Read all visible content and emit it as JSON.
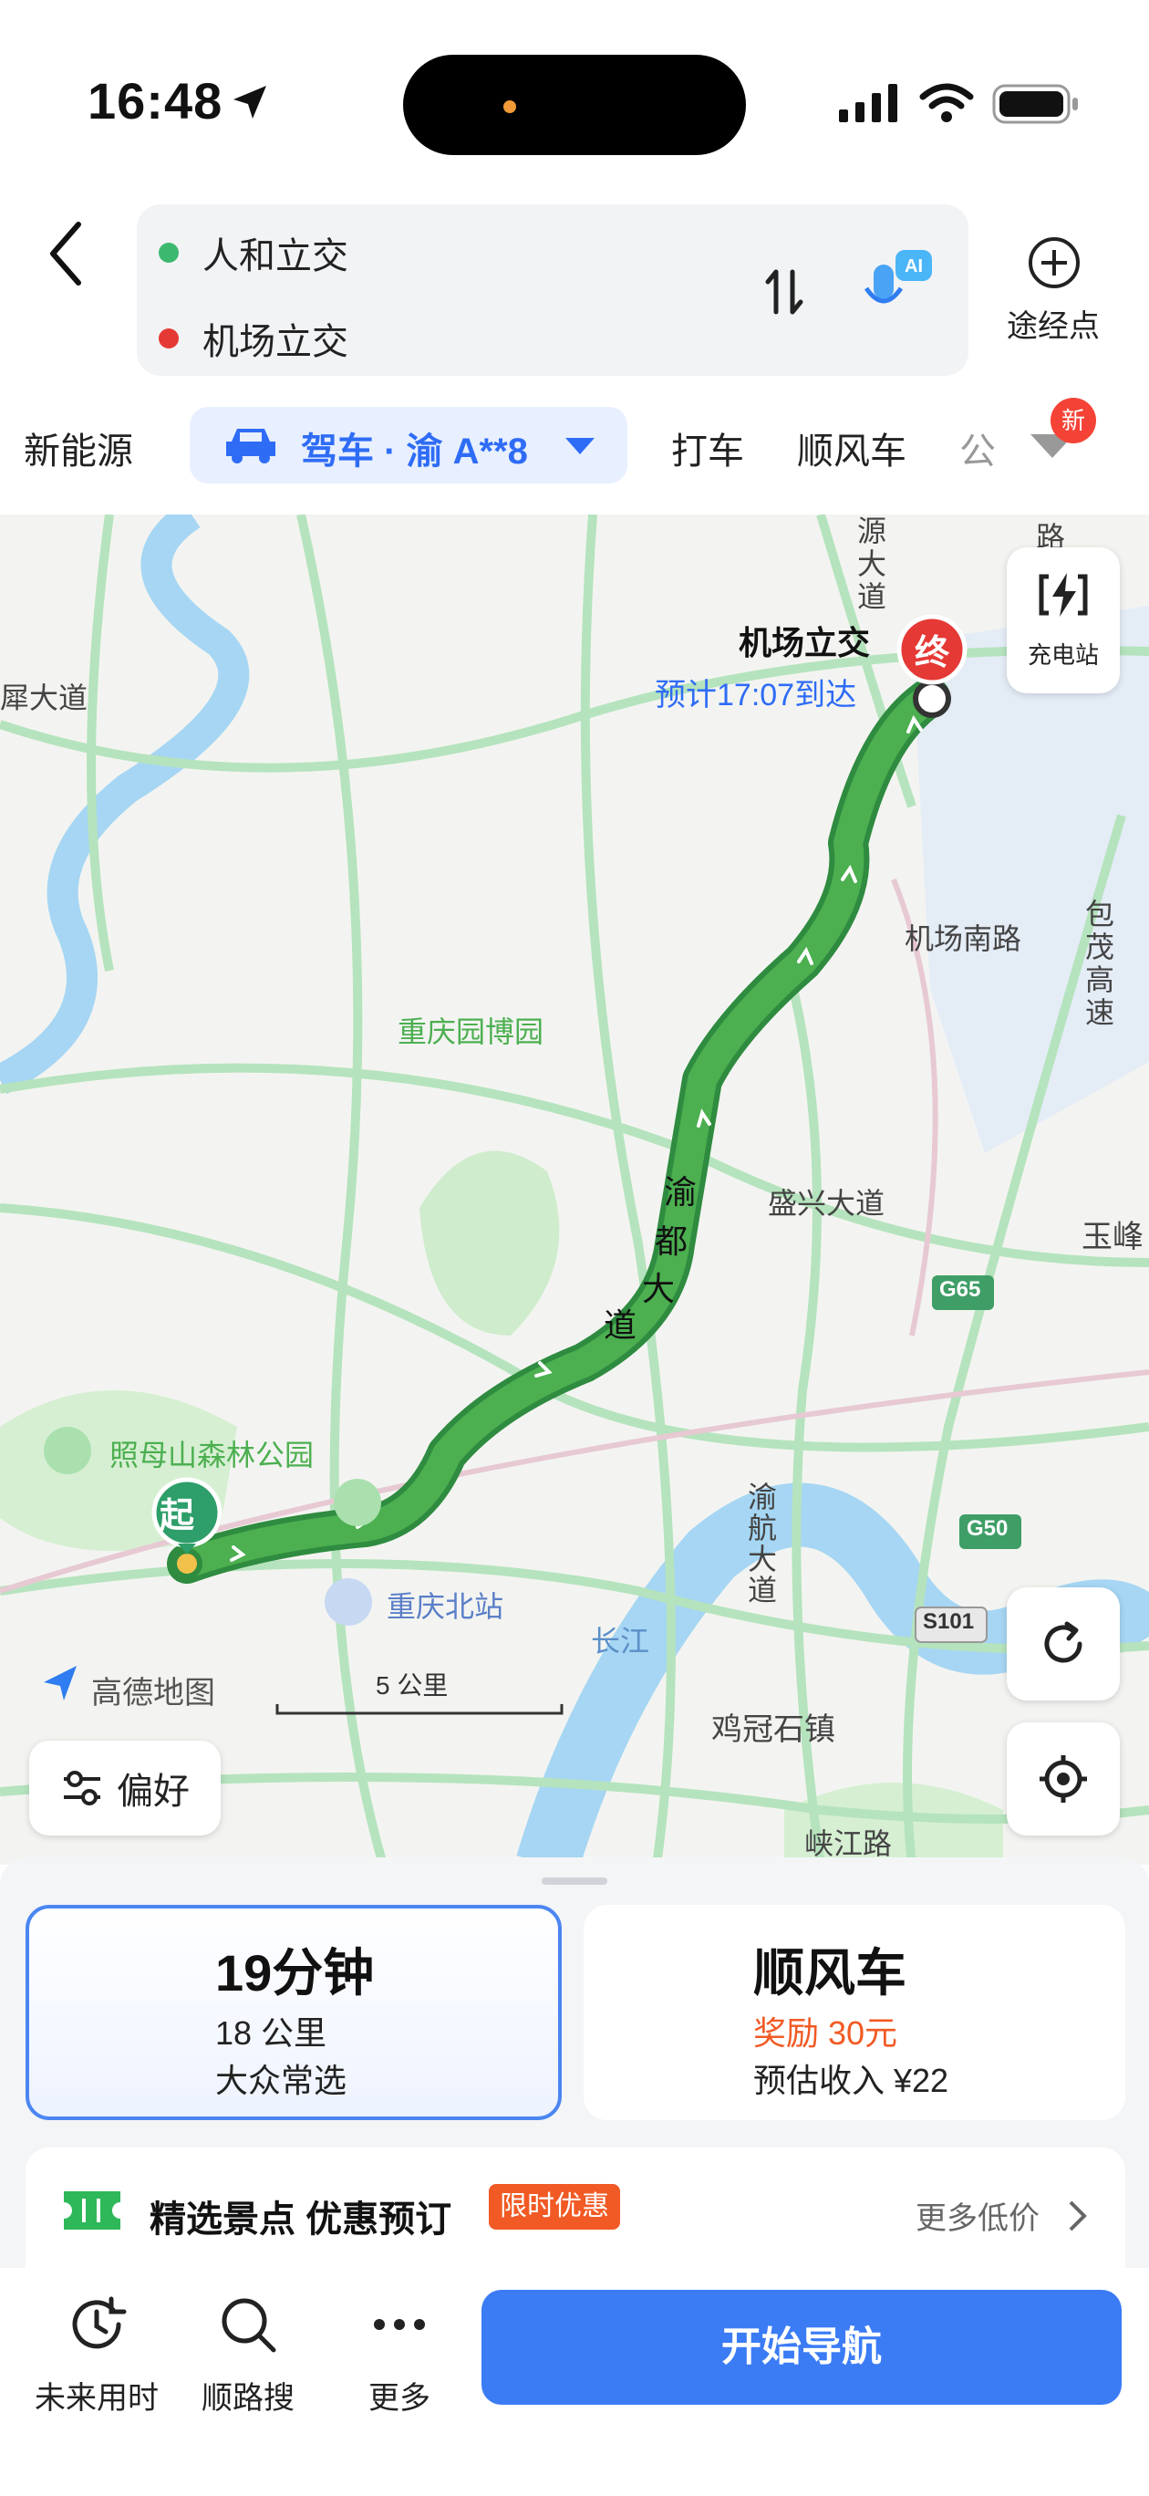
{
  "status_bar": {
    "time": "16:48"
  },
  "route": {
    "from": "人和立交",
    "to": "机场立交",
    "swap_icon": "swap-vertical-icon",
    "ai_label": "AI",
    "waypoint_label": "途经点"
  },
  "tabs": {
    "new_energy": "新能源",
    "driving": "驾车 · 渝 A**8",
    "taxi": "打车",
    "carpool": "顺风车",
    "bus_partial": "公",
    "new_badge": "新"
  },
  "map": {
    "end_marker": "终",
    "start_marker": "起",
    "destination_label": "机场立交",
    "eta": "预计17:07到达",
    "charging_label": "充电站",
    "road_labels": {
      "yudu_1": "渝",
      "yudu_2": "都",
      "yudu_3": "大",
      "yudu_4": "道",
      "shengxing": "盛兴大道",
      "airport_south": "机场南路",
      "baomao": "包茂高速",
      "yuhang": "渝航大道",
      "changjiang": "长江",
      "xiajiang": "峡江路",
      "jixiang": "鸡冠石镇",
      "yufeng": "玉峰",
      "yuanda": "源大道",
      "xiaxi": "犀大道",
      "lu": "路"
    },
    "pois": {
      "garden_expo": "重庆园博园",
      "zhaomushan": "照母山森林公园",
      "north_station": "重庆北站"
    },
    "highway_shields": [
      "G65",
      "G50",
      "S101"
    ],
    "logo": "高德地图",
    "scale": "5 公里",
    "preference_button": "偏好"
  },
  "route_cards": [
    {
      "title": "19分钟",
      "line1": "18 公里",
      "line2": "大众常选"
    },
    {
      "title": "顺风车",
      "line1": "奖励 30元",
      "line2": "预估收入 ¥22"
    }
  ],
  "promo": {
    "title": "精选景点 优惠预订",
    "tag": "限时优惠",
    "more": "更多低价"
  },
  "bottom_bar": {
    "future": "未来用时",
    "search_along": "顺路搜",
    "more": "更多",
    "start_nav": "开始导航"
  },
  "colors": {
    "accent": "#3b7cf5",
    "route": "#4caf50",
    "route_border": "#2e8b3f",
    "warning": "#f15a24",
    "end_marker": "#e53935",
    "start_marker": "#2e9e6a"
  }
}
